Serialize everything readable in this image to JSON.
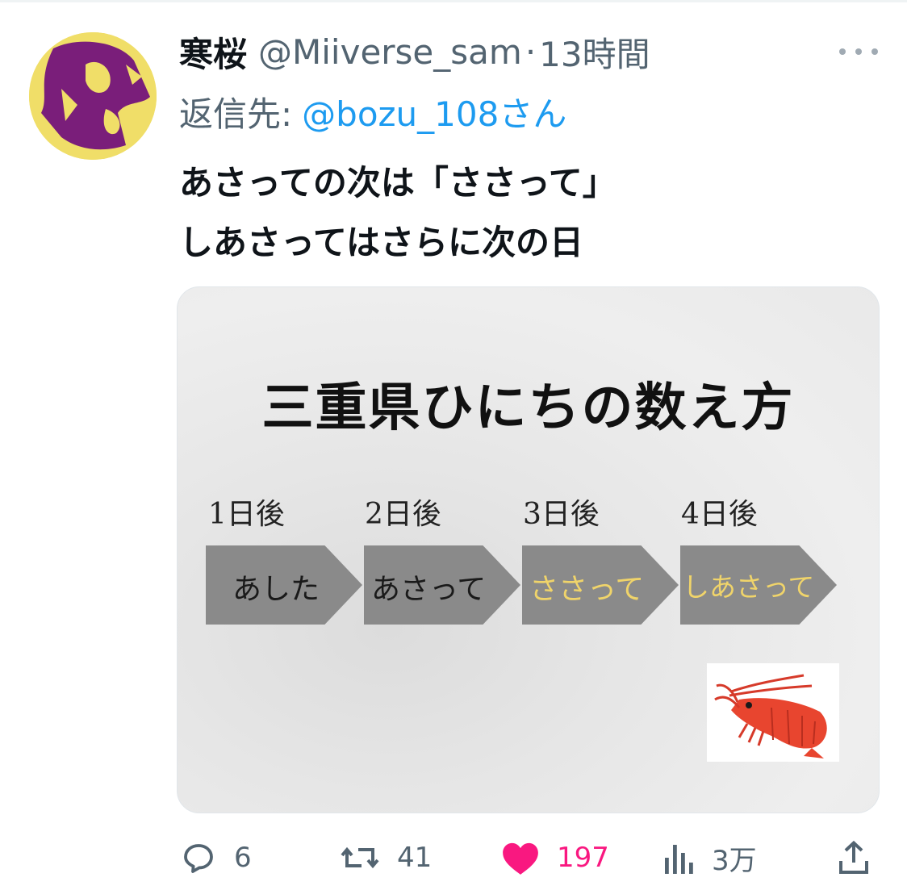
{
  "tweet": {
    "display_name": "寒桜",
    "handle": "@Miiverse_sam",
    "separator": "·",
    "time": "13時間",
    "reply_prefix": "返信先:",
    "reply_target": "@bozu_108さん",
    "text_lines": [
      "あさっての次は「ささって」",
      "しあさってはさらに次の日"
    ]
  },
  "media": {
    "title": "三重県ひにちの数え方",
    "days": [
      {
        "label": "1日後",
        "word": "あした",
        "highlight": false
      },
      {
        "label": "2日後",
        "word": "あさって",
        "highlight": false
      },
      {
        "label": "3日後",
        "word": "ささって",
        "highlight": true
      },
      {
        "label": "4日後",
        "word": "しあさって",
        "highlight": true
      }
    ],
    "image_icon": "shrimp-icon"
  },
  "actions": {
    "reply_count": "6",
    "retweet_count": "41",
    "like_count": "197",
    "view_count": "3万",
    "icons": [
      "reply-icon",
      "retweet-icon",
      "heart-icon",
      "views-icon",
      "share-icon"
    ]
  },
  "colors": {
    "text": "#0f1419",
    "secondary": "#536471",
    "link": "#1d9bf0",
    "like": "#f91880",
    "arrow_fill": "#8a8a8a",
    "highlight_text": "#f0d46a"
  }
}
